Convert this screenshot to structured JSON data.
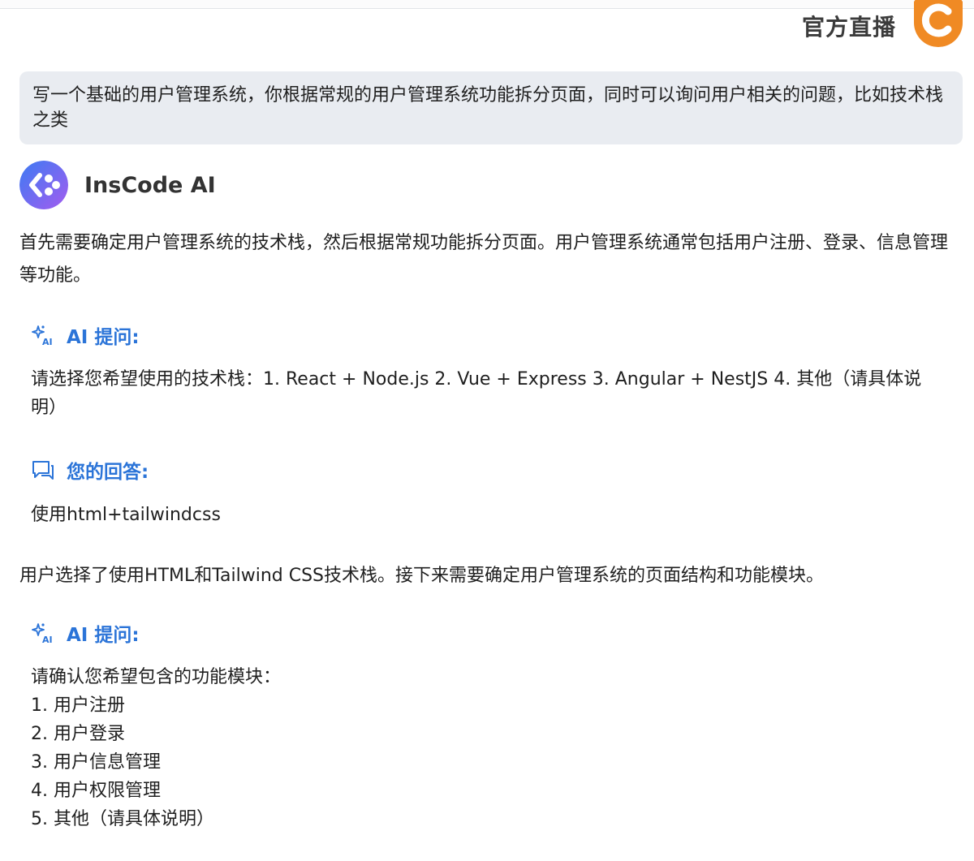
{
  "header": {
    "live_label": "官方直播"
  },
  "user_message": {
    "text": "写一个基础的用户管理系统，你根据常规的用户管理系统功能拆分页面，同时可以询问用户相关的问题，比如技术栈之类"
  },
  "assistant": {
    "name": "InsCode AI",
    "intro": "首先需要确定用户管理系统的技术栈，然后根据常规功能拆分页面。用户管理系统通常包括用户注册、登录、信息管理等功能。",
    "question1": {
      "label": "AI 提问:",
      "text": "请选择您希望使用的技术栈：1. React + Node.js 2. Vue + Express 3. Angular + NestJS 4. 其他（请具体说明）"
    },
    "answer1": {
      "label": "您的回答:",
      "text": "使用html+tailwindcss"
    },
    "followup": "用户选择了使用HTML和Tailwind CSS技术栈。接下来需要确定用户管理系统的页面结构和功能模块。",
    "question2": {
      "label": "AI 提问:",
      "intro": "请确认您希望包含的功能模块：",
      "options": [
        "1. 用户注册",
        "2. 用户登录",
        "3. 用户信息管理",
        "4. 用户权限管理",
        "5. 其他（请具体说明）"
      ]
    }
  },
  "colors": {
    "accent_blue": "#2b74d8",
    "bubble_bg": "#e9ecf1",
    "logo_orange": "#f08a24"
  },
  "icons": {
    "live_logo": "csdn-logo-icon",
    "assistant_avatar": "inscode-avatar-icon",
    "question": "ai-sparkle-icon",
    "answer": "chat-bubble-icon"
  }
}
